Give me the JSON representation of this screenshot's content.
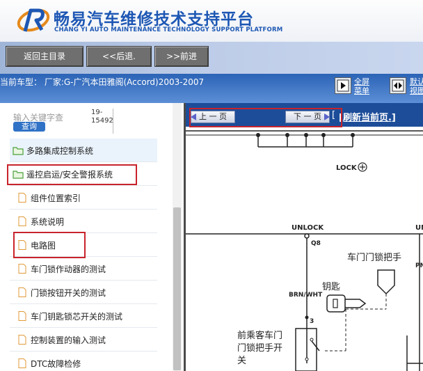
{
  "header": {
    "title": "畅易汽车维修技术支持平台",
    "subtitle": "CHANG YI AUTO MAINTENANCE TECHNOLOGY SUPPORT PLATFORM",
    "logo_letter": "R"
  },
  "toolbar": {
    "home": "返回主目录",
    "back": "<<后退.",
    "forward": ">>前进"
  },
  "vehicle": {
    "current": "当前车型： 厂家:G-广汽本田雅阁(Accord)2003-2007",
    "full_menu_l1": "全屏",
    "full_menu_l2": "菜单",
    "view_l1": "默认",
    "view_l2": "视图"
  },
  "search": {
    "label": "输入关键字查",
    "button": "查询",
    "num_l1": "19-",
    "num_l2": "15492"
  },
  "tree": {
    "items": [
      {
        "label": "多路集成控制系统"
      },
      {
        "label": "遥控启运/安全警报系统"
      },
      {
        "label": "组件位置索引"
      },
      {
        "label": "系统说明"
      },
      {
        "label": "电路图"
      },
      {
        "label": "车门锁作动器的测试"
      },
      {
        "label": "门锁按钮开关的测试"
      },
      {
        "label": "车门钥匙锁芯开关的测试"
      },
      {
        "label": "控制装置的输入测试"
      },
      {
        "label": "DTC故障检修"
      }
    ]
  },
  "viewer": {
    "prev": "上 一 页",
    "next": "下 一 页",
    "refresh": "[刷新当前页.]",
    "bracket": "[",
    "diagram": {
      "lock": "LOCK",
      "unlock": "UNLOCK",
      "unlock_right": "UN",
      "q8": "Q8",
      "door_handle": "车门门锁把手",
      "pn": "PN",
      "key": "钥匙",
      "wire": "BRN/WHT",
      "pin": "3",
      "passenger_l1": "前乘客车门",
      "passenger_l2": "门锁把手开",
      "passenger_l3": "关"
    }
  },
  "colors": {
    "brand_blue": "#1d57b4",
    "nav_blue": "#1d4d99",
    "highlight_red": "#c8232c"
  }
}
